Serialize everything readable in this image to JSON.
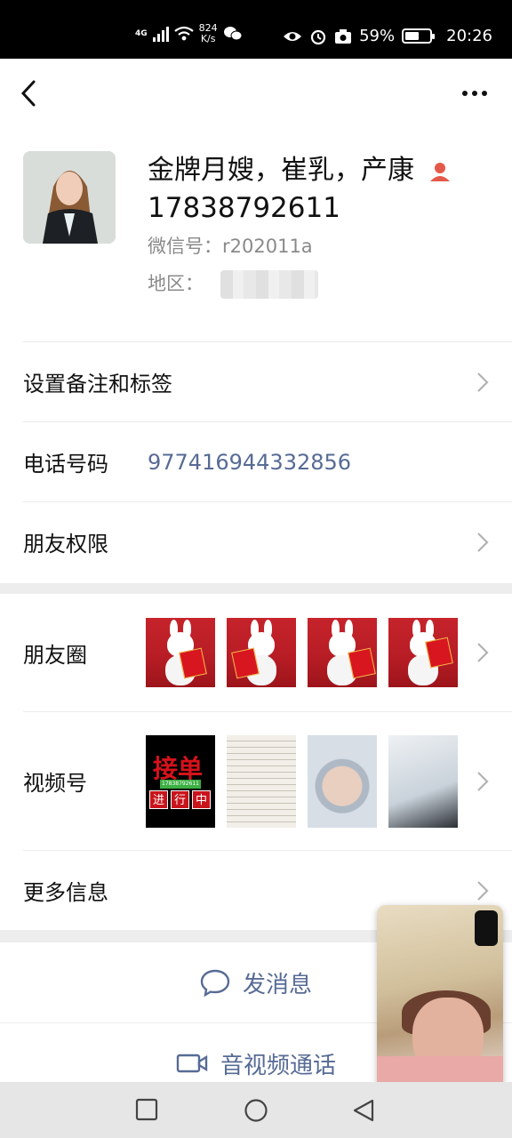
{
  "status_bar": {
    "network": "4G",
    "speed_value": "824",
    "speed_unit": "K/s",
    "battery_percent": "59%",
    "battery_level": 0.59,
    "time": "20:26"
  },
  "header": {
    "back_icon": "chevron-left-icon",
    "more_icon": "more-icon"
  },
  "profile": {
    "name": "金牌月嫂，崔乳，产康",
    "phone_display": "17838792611",
    "wechat_id": "微信号：r202011a",
    "region_label": "地区："
  },
  "rows": {
    "remark": "设置备注和标签",
    "phone_label": "电话号码",
    "phone_value": "977416944332856",
    "permissions": "朋友权限",
    "moments": "朋友圈",
    "channels": "视频号",
    "more_info": "更多信息"
  },
  "channel_thumb": {
    "title": "接单",
    "phone": "17838792611",
    "chars": [
      "进",
      "行",
      "中"
    ]
  },
  "actions": {
    "message": "发消息",
    "call": "音视频通话"
  },
  "colors": {
    "link_blue": "#576b95",
    "accent_red": "#e45a4a"
  }
}
